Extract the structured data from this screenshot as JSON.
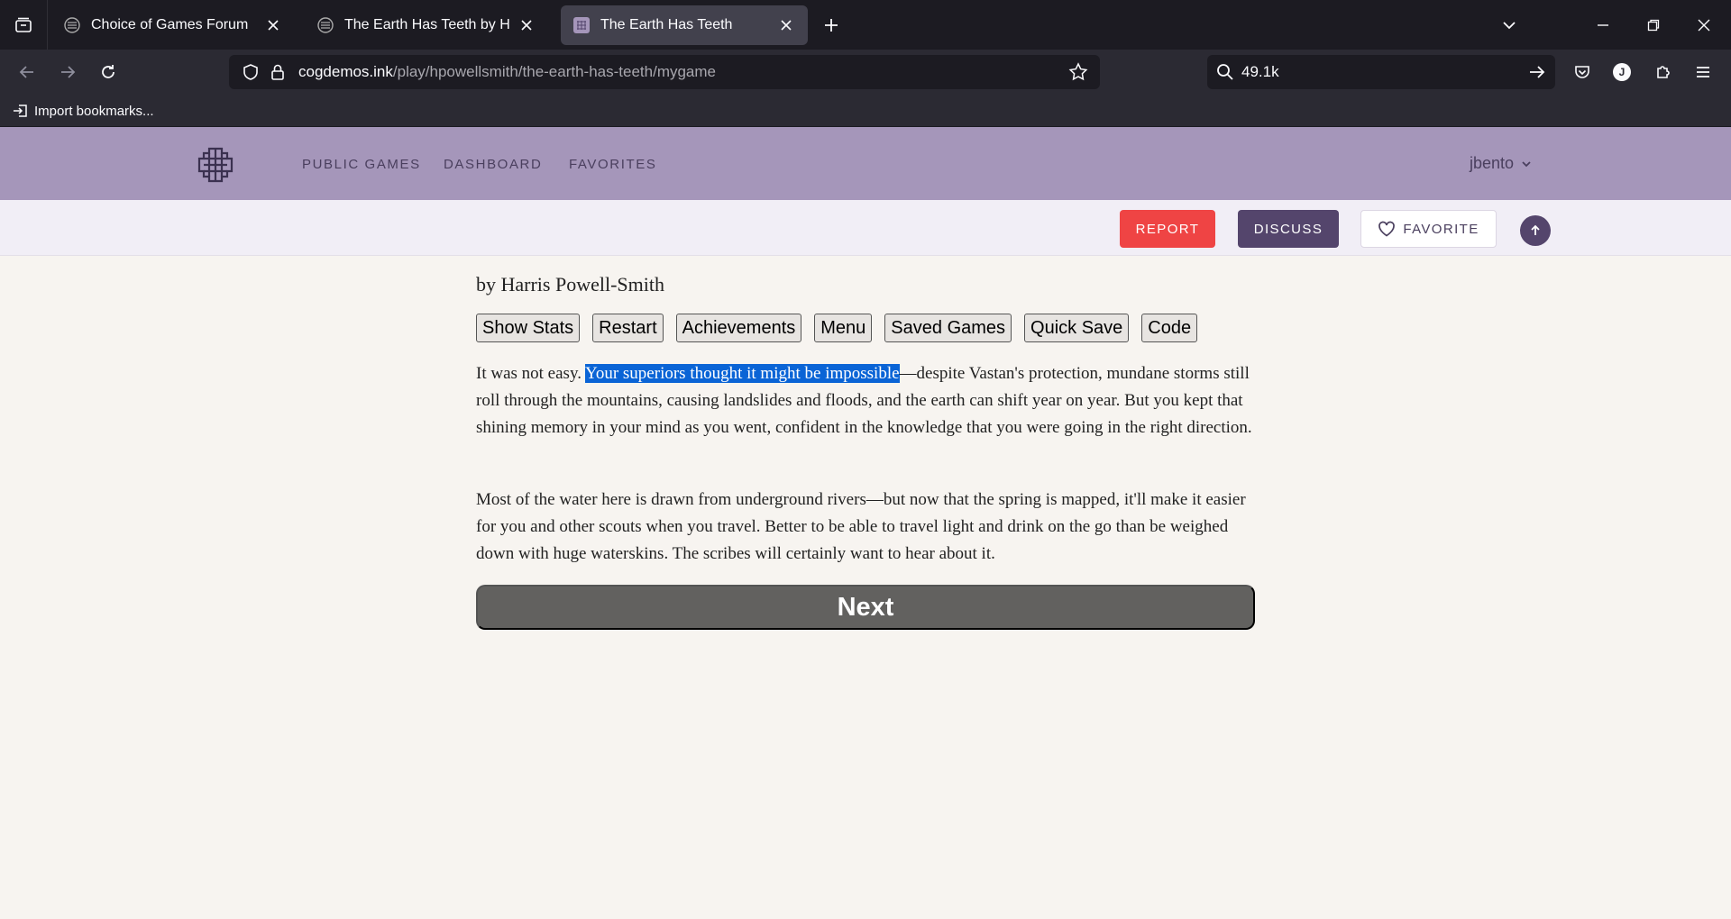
{
  "browser": {
    "tabs": [
      {
        "title": "Choice of Games Forum",
        "active": false
      },
      {
        "title": "The Earth Has Teeth by Harris Powell-Smith",
        "active": false
      },
      {
        "title": "The Earth Has Teeth",
        "active": true
      }
    ],
    "url_domain": "cogdemos.ink",
    "url_path": "/play/hpowellsmith/the-earth-has-teeth/mygame",
    "search_value": "49.1k",
    "bookmarks": [
      {
        "label": "Import bookmarks..."
      }
    ],
    "profile_initial": "J"
  },
  "site": {
    "nav": [
      "PUBLIC GAMES",
      "DASHBOARD",
      "FAVORITES"
    ],
    "username": "jbento",
    "actions": {
      "report": "REPORT",
      "discuss": "DISCUSS",
      "favorite": "FAVORITE"
    },
    "colors": {
      "header": "#a596ba",
      "report": "#ef4444",
      "discuss": "#54456c"
    }
  },
  "game": {
    "byline": "by Harris Powell-Smith",
    "buttons": [
      "Show Stats",
      "Restart",
      "Achievements",
      "Menu",
      "Saved Games",
      "Quick Save",
      "Code"
    ],
    "paragraph1": {
      "before": "It was not easy. ",
      "selected": "Your superiors thought it might be impossible",
      "after": "—despite Vastan's protection, mundane storms still roll through the mountains, causing landslides and floods, and the earth can shift year on year. But you kept that shining memory in your mind as you went, confident in the knowledge that you were going in the right direction."
    },
    "paragraph2": "Most of the water here is drawn from underground rivers—but now that the spring is mapped, it'll make it easier for you and other scouts when you travel. Better to be able to travel light and drink on the go than be weighed down with huge waterskins. The scribes will certainly want to hear about it.",
    "next_label": "Next"
  }
}
